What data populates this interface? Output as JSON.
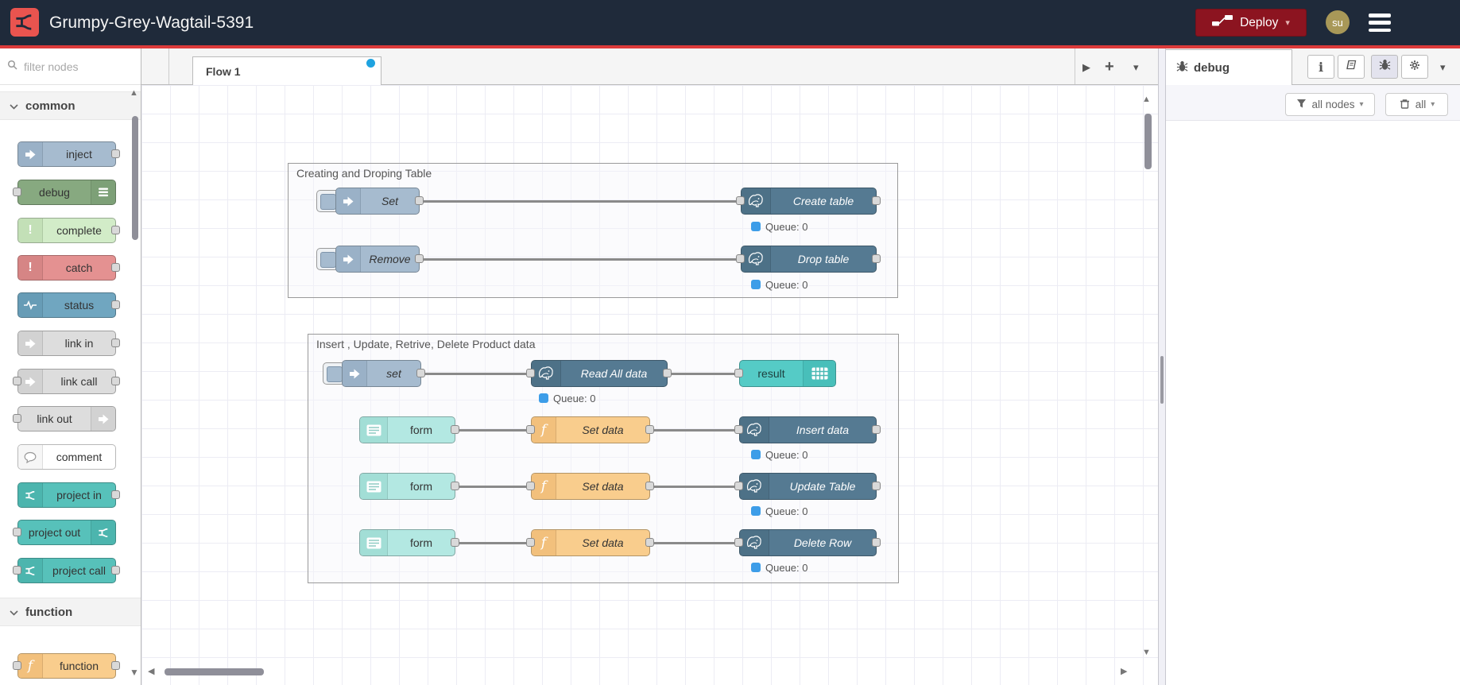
{
  "header": {
    "app_title": "Grumpy-Grey-Wagtail-5391",
    "deploy_label": "Deploy",
    "user_initials": "su"
  },
  "palette": {
    "filter_placeholder": "filter nodes",
    "categories": [
      {
        "label": "common",
        "items": [
          {
            "label": "inject"
          },
          {
            "label": "debug"
          },
          {
            "label": "complete"
          },
          {
            "label": "catch"
          },
          {
            "label": "status"
          },
          {
            "label": "link in"
          },
          {
            "label": "link call"
          },
          {
            "label": "link out"
          },
          {
            "label": "comment"
          },
          {
            "label": "project in"
          },
          {
            "label": "project out"
          },
          {
            "label": "project call"
          }
        ]
      },
      {
        "label": "function",
        "items": [
          {
            "label": "function"
          }
        ]
      }
    ]
  },
  "workspace": {
    "tab_label": "Flow 1"
  },
  "flow": {
    "groups": [
      {
        "label": "Creating and Droping Table"
      },
      {
        "label": "Insert , Update, Retrive, Delete Product data"
      }
    ],
    "nodes": {
      "set1": "Set",
      "create_table": "Create table",
      "remove": "Remove",
      "drop_table": "Drop table",
      "set2": "set",
      "read_all": "Read All data",
      "result": "result",
      "form": "form",
      "set_data": "Set data",
      "insert_data": "Insert data",
      "update_table": "Update Table",
      "delete_row": "Delete Row"
    },
    "queue_label": "Queue: 0"
  },
  "sidebar": {
    "tab_label": "debug",
    "filter_label": "all nodes",
    "clear_label": "all"
  },
  "icons": {
    "play": "▶",
    "plus": "+",
    "chevron_down": "▾",
    "scroll_up": "▲",
    "scroll_down": "▼",
    "scroll_left": "◀",
    "scroll_right": "▶",
    "info": "i",
    "exclaim": "!",
    "fn": "f"
  },
  "colors": {
    "header_bg": "#1f2a3a",
    "accent_red": "#dc3a3a",
    "logo_red": "#e9544f",
    "deploy_bg": "#8c1420",
    "avatar_bg": "#a89858",
    "unsaved_dot": "#1fa3e0",
    "queue_badge": "#3d9de8",
    "inject": "#a6bbcf",
    "debug": "#87a980",
    "complete": "#d2ecc8",
    "catch": "#e49191",
    "status": "#70a6c0",
    "link": "#dddddd",
    "comment": "#ffffff",
    "project": "#57c1ba",
    "function": "#f9cd8d",
    "postgresql": "#557a92",
    "form": "#b3e8e2",
    "result": "#55cbc6"
  }
}
